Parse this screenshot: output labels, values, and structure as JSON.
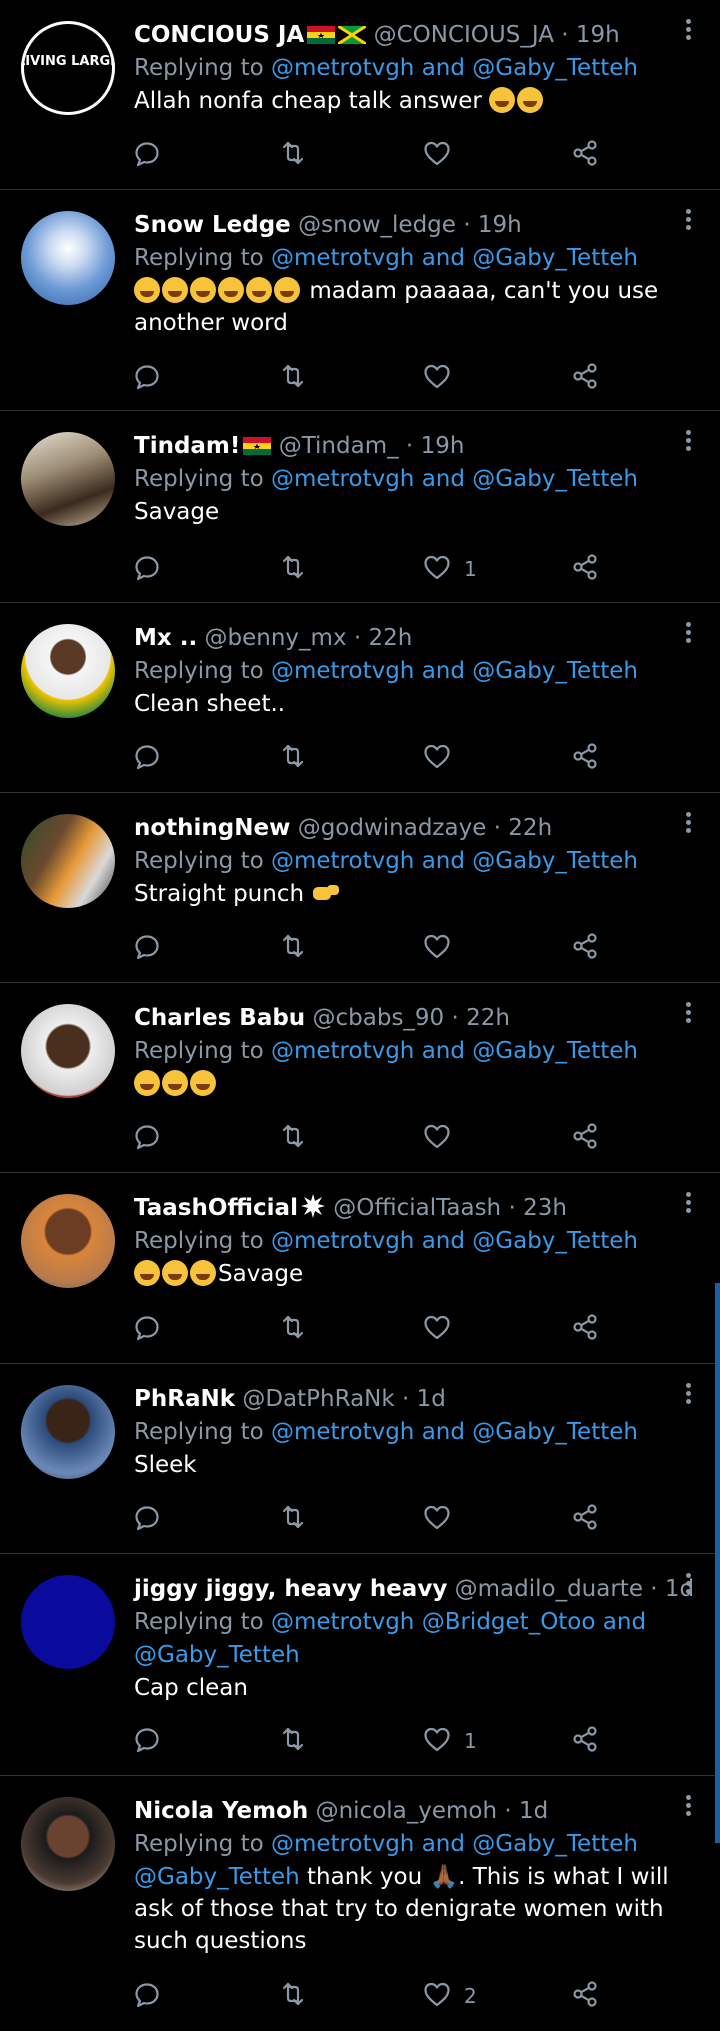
{
  "replying_label": "Replying to",
  "tweets": [
    {
      "name": "CONCIOUS JA",
      "handle": "@CONCIOUS_JA",
      "time": "19h",
      "reply_to": "@metrotvgh and @Gaby_Tetteh",
      "text": "Allah nonfa cheap talk answer",
      "likes": "",
      "avatar_logo": "LIVING LARGE"
    },
    {
      "name": "Snow Ledge",
      "handle": "@snow_ledge",
      "time": "19h",
      "reply_to": "@metrotvgh and @Gaby_Tetteh",
      "text": "madam paaaaa, can't you use another word",
      "likes": ""
    },
    {
      "name": "Tindam!",
      "handle": "@Tindam_",
      "time": "19h",
      "reply_to": "@metrotvgh and @Gaby_Tetteh",
      "text": "Savage",
      "likes": "1"
    },
    {
      "name": "Mx ..",
      "handle": "@benny_mx",
      "time": "22h",
      "reply_to": "@metrotvgh and @Gaby_Tetteh",
      "text": "Clean sheet..",
      "likes": ""
    },
    {
      "name": "nothingNew",
      "handle": "@godwinadzaye",
      "time": "22h",
      "reply_to": "@metrotvgh and @Gaby_Tetteh",
      "text": "Straight punch",
      "likes": ""
    },
    {
      "name": "Charles Babu",
      "handle": "@cbabs_90",
      "time": "22h",
      "reply_to": "@metrotvgh and @Gaby_Tetteh",
      "text": "",
      "likes": ""
    },
    {
      "name": "TaashOfficial",
      "handle": "@OfficialTaash",
      "time": "23h",
      "reply_to": "@metrotvgh and @Gaby_Tetteh",
      "text": "Savage",
      "likes": ""
    },
    {
      "name": "PhRaNk",
      "handle": "@DatPhRaNk",
      "time": "1d",
      "reply_to": "@metrotvgh and @Gaby_Tetteh",
      "text": "Sleek",
      "likes": ""
    },
    {
      "name": "jiggy jiggy, heavy heavy",
      "handle": "@madilo_duarte",
      "time": "1d",
      "reply_to": "@metrotvgh @Bridget_Otoo and @Gaby_Tetteh",
      "text": "Cap clean",
      "likes": "1"
    },
    {
      "name": "Nicola Yemoh",
      "handle": "@nicola_yemoh",
      "time": "1d",
      "reply_to": "@metrotvgh and @Gaby_Tetteh",
      "text_mention": "@Gaby_Tetteh",
      "text": "thank you 🙏🏾. This is what I will ask of those that try to denigrate women with such questions",
      "likes": "2"
    }
  ],
  "colors": {
    "background": "#000000",
    "link": "#3b9ae8",
    "muted": "#8b98a5",
    "divider": "#2f3336",
    "scrollbar": "#1d5fa3"
  },
  "icons": [
    "reply-icon",
    "retweet-icon",
    "like-icon",
    "share-icon",
    "more-icon"
  ]
}
